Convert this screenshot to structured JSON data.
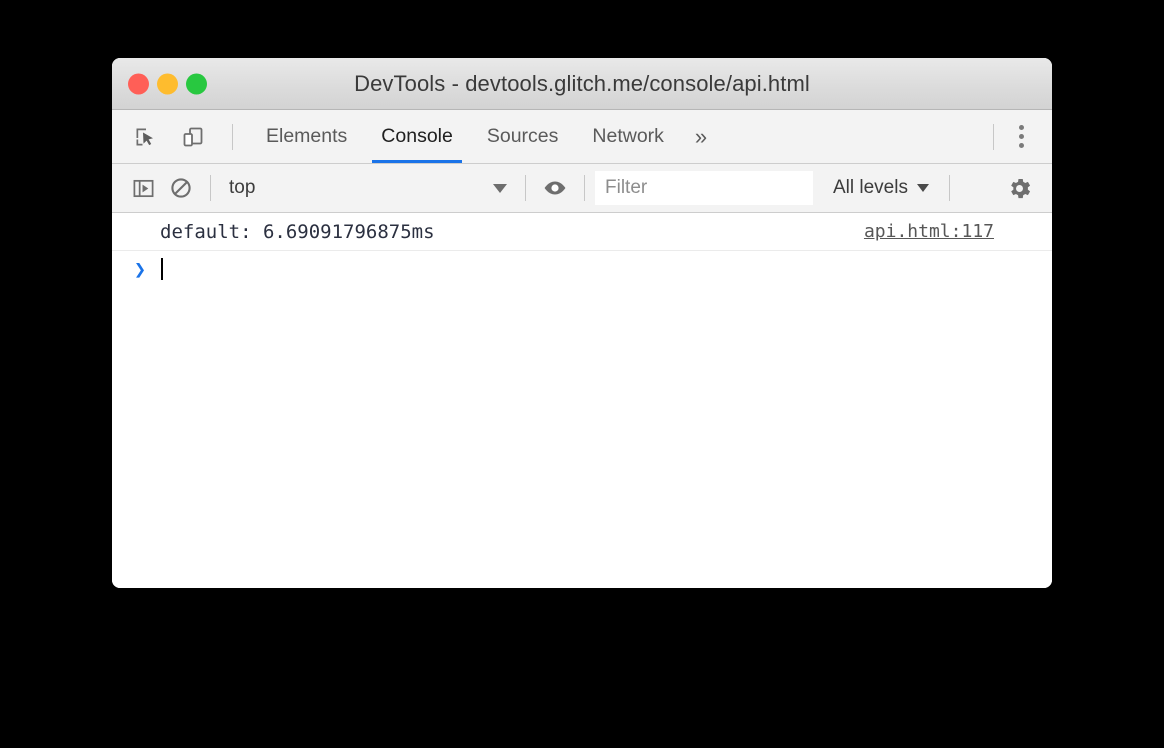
{
  "window": {
    "title": "DevTools - devtools.glitch.me/console/api.html",
    "traffic_lights": {
      "close": "close-window",
      "minimize": "minimize-window",
      "zoom": "zoom-window",
      "close_color": "#ff5f57",
      "minimize_color": "#febc2e",
      "zoom_color": "#28c840"
    }
  },
  "tabbar": {
    "inspect_icon": "inspect-element-icon",
    "device_icon": "device-toolbar-icon",
    "tabs": [
      {
        "label": "Elements",
        "active": false
      },
      {
        "label": "Console",
        "active": true
      },
      {
        "label": "Sources",
        "active": false
      },
      {
        "label": "Network",
        "active": false
      }
    ],
    "more_tabs_label": "»",
    "menu_icon": "kebab-menu-icon",
    "active_tab_underline_color": "#1a73e8"
  },
  "console_toolbar": {
    "sidebar_toggle_icon": "console-sidebar-toggle-icon",
    "clear_icon": "clear-console-icon",
    "context_value": "top",
    "eye_icon": "live-expression-eye-icon",
    "filter_placeholder": "Filter",
    "filter_value": "",
    "levels_label": "All levels",
    "settings_icon": "settings-gear-icon"
  },
  "console_body": {
    "messages": [
      {
        "text": "default: 6.69091796875ms",
        "source_link": "api.html:117"
      }
    ],
    "prompt_symbol": "❯",
    "prompt_value": ""
  }
}
